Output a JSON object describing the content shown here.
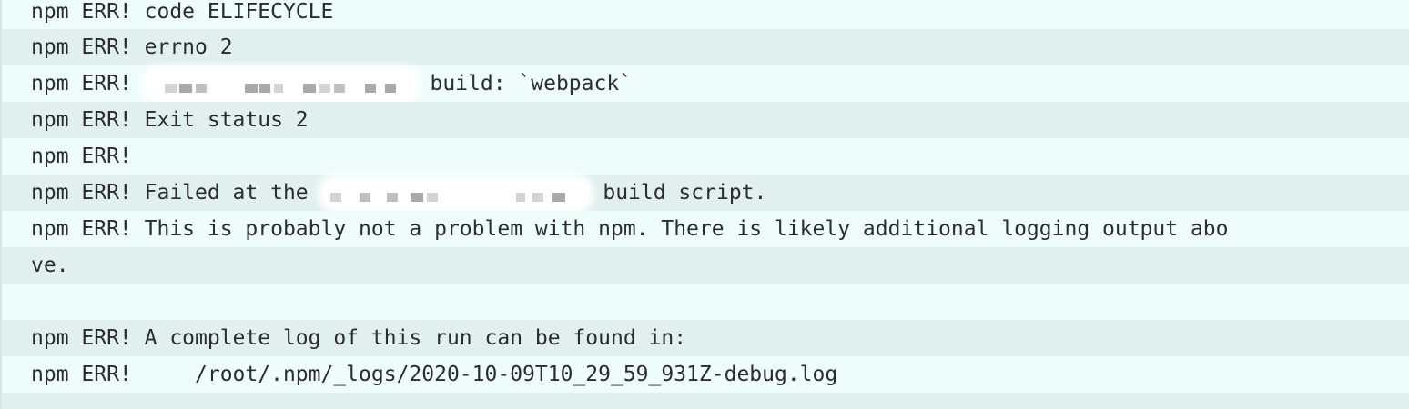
{
  "terminal": {
    "lines": [
      {
        "prefix": "npm ERR!",
        "text": " code ELIFECYCLE"
      },
      {
        "prefix": "npm ERR!",
        "text": " errno 2"
      },
      {
        "prefix": "npm ERR!",
        "text": " build: `webpack`"
      },
      {
        "prefix": "npm ERR!",
        "text": " Exit status 2"
      },
      {
        "prefix": "npm ERR!",
        "text": ""
      },
      {
        "prefix": "npm ERR!",
        "text_before": " Failed at the ",
        "text_after": " build script."
      },
      {
        "prefix": "npm ERR!",
        "text": " This is probably not a problem with npm. There is likely additional logging output abo"
      },
      {
        "prefix": "",
        "text": "ve."
      },
      {
        "prefix": "",
        "text": ""
      },
      {
        "prefix": "npm ERR!",
        "text": " A complete log of this run can be found in:"
      },
      {
        "prefix": "npm ERR!",
        "text": "     /root/.npm/_logs/2020-10-09T10_29_59_931Z-debug.log"
      }
    ]
  },
  "colors": {
    "background": "#effcfc",
    "stripe": "#e1efef",
    "text": "#2c2c2c"
  }
}
